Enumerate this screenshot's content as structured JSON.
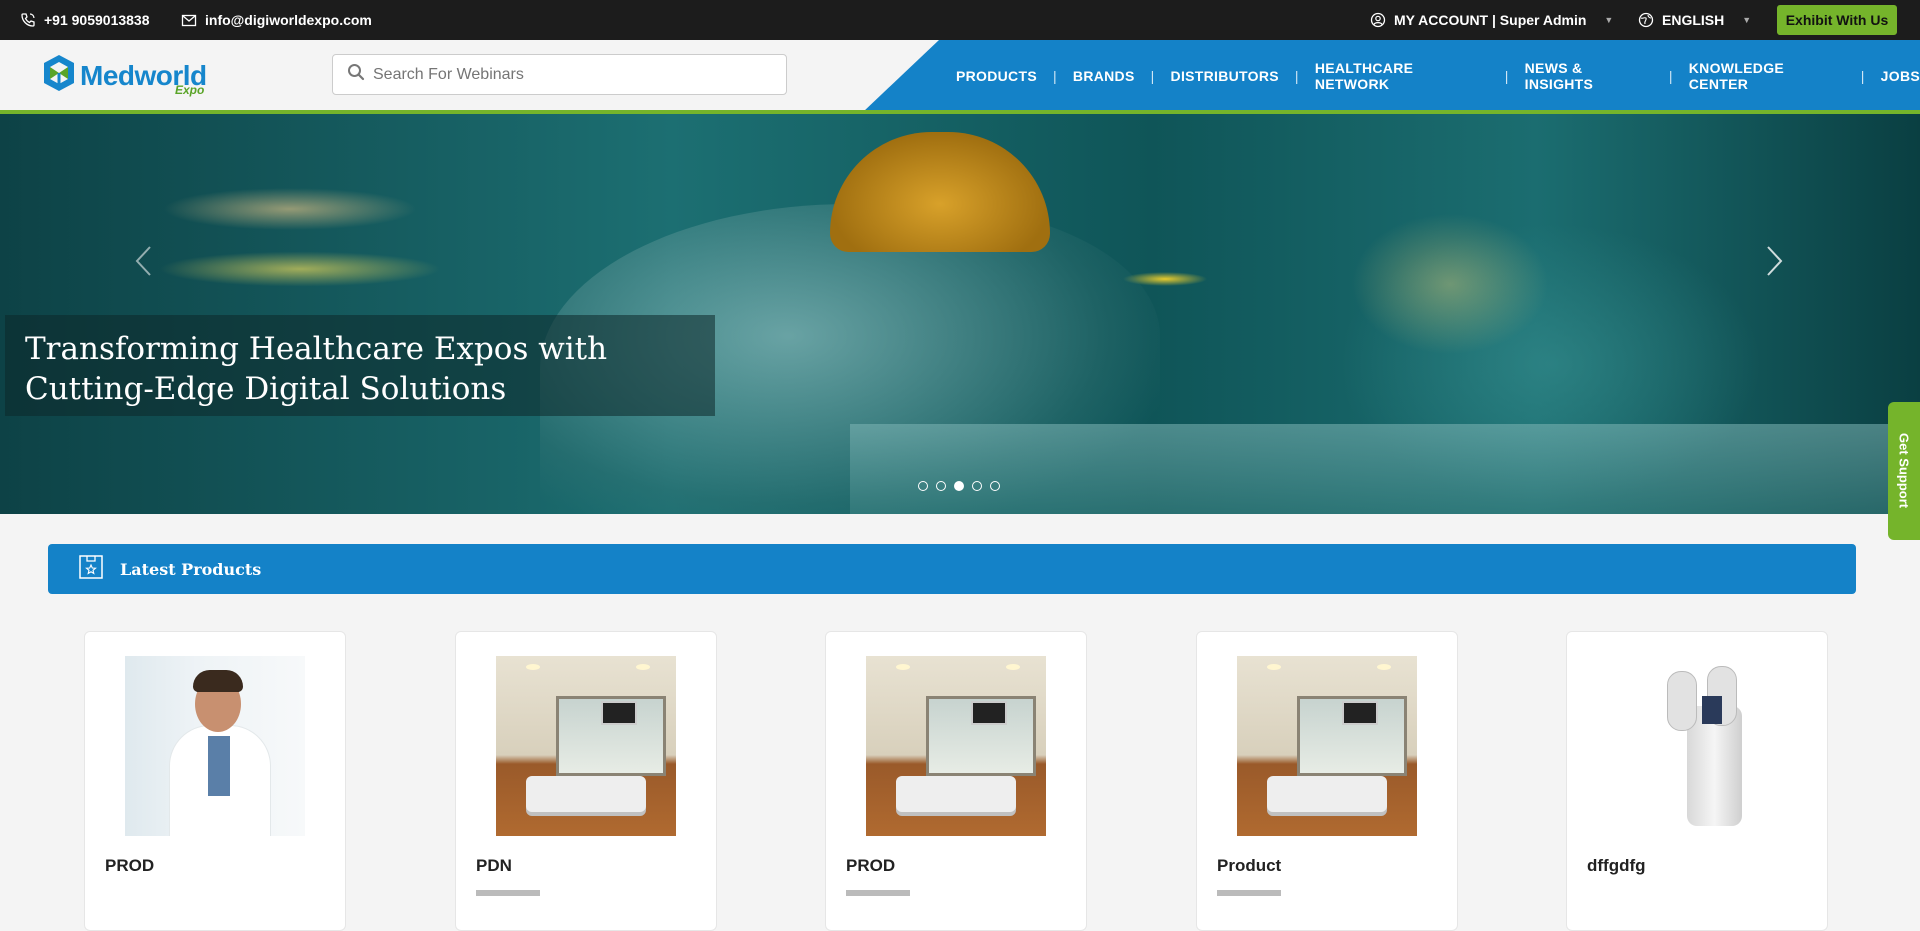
{
  "topbar": {
    "phone": "+91 9059013838",
    "email": "info@digiworldexpo.com",
    "account": "MY ACCOUNT | Super Admin",
    "language": "ENGLISH",
    "exhibit_label": "Exhibit With Us"
  },
  "header": {
    "logo_main": "Medworld",
    "logo_sub": "Expo",
    "search_placeholder": "Search For Webinars",
    "nav": [
      "PRODUCTS",
      "BRANDS",
      "DISTRIBUTORS",
      "HEALTHCARE NETWORK",
      "NEWS & INSIGHTS",
      "KNOWLEDGE CENTER",
      "JOBS"
    ]
  },
  "hero": {
    "caption_line1": "Transforming Healthcare Expos with",
    "caption_line2": "Cutting-Edge Digital Solutions",
    "slide_count": 5,
    "active_slide": 3
  },
  "support_label": "Get Support",
  "section": {
    "title": "Latest Products"
  },
  "products": [
    {
      "name": "PROD",
      "image": "doctor-photo"
    },
    {
      "name": "PDN",
      "image": "hospital-room-photo"
    },
    {
      "name": "PROD",
      "image": "hospital-room-photo"
    },
    {
      "name": "Product",
      "image": "hospital-room-photo"
    },
    {
      "name": "dffgdfg",
      "image": "medical-device-photo"
    }
  ],
  "colors": {
    "brand_blue": "#1482c8",
    "brand_green": "#75b42b",
    "topbar": "#1c1c1c"
  }
}
